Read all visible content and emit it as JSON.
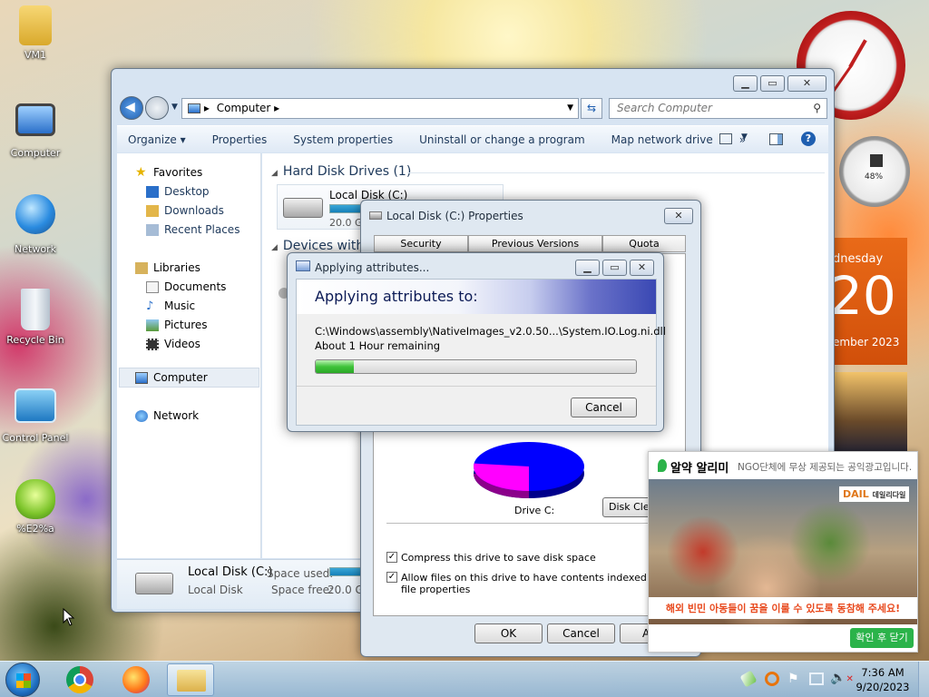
{
  "desktop": {
    "icons": [
      {
        "label": "VM1"
      },
      {
        "label": "Computer"
      },
      {
        "label": "Network"
      },
      {
        "label": "Recycle Bin"
      },
      {
        "label": "Control Panel"
      },
      {
        "label": "%E2%a"
      }
    ]
  },
  "gadgets": {
    "gauge_label": "48%",
    "calendar_day_name": "dnesday",
    "calendar_day": "20",
    "calendar_month": "ember 2023"
  },
  "explorer": {
    "breadcrumb": "Computer",
    "search_placeholder": "Search Computer",
    "toolbar": [
      "Organize",
      "Properties",
      "System properties",
      "Uninstall or change a program",
      "Map network drive",
      "»"
    ],
    "favorites_header": "Favorites",
    "favorites": [
      "Desktop",
      "Downloads",
      "Recent Places"
    ],
    "libraries_header": "Libraries",
    "libraries": [
      "Documents",
      "Music",
      "Pictures",
      "Videos"
    ],
    "computer": "Computer",
    "network": "Network",
    "group_hdd": "Hard Disk Drives (1)",
    "group_devices": "Devices with",
    "drive_name": "Local Disk (C:)",
    "drive_size": "20.0 GB",
    "details_name": "Local Disk (C:)",
    "details_type": "Local Disk",
    "details_space_used_label": "Space used:",
    "details_space_free_label": "Space free:",
    "details_space_free": "20.0 GB"
  },
  "properties": {
    "title": "Local Disk (C:) Properties",
    "tabs": [
      "Security",
      "Previous Versions",
      "Quota"
    ],
    "drive_label": "Drive C:",
    "disk_cleanup": "Disk Clea",
    "compress_label": "Compress this drive to save disk space",
    "index_label_line1": "Allow files on this drive to have contents indexed in additio",
    "index_label_line2": "file properties",
    "ok": "OK",
    "cancel": "Cancel",
    "apply": "A",
    "pie": {
      "used_fraction": 0.27,
      "used_color": "#ff00ff",
      "free_color": "#0000ff"
    }
  },
  "applying": {
    "title": "Applying attributes...",
    "heading": "Applying attributes to:",
    "path": "C:\\Windows\\assembly\\NativeImages_v2.0.50...\\System.IO.Log.ni.dll",
    "remaining": "About 1 Hour remaining",
    "progress_fraction": 0.12,
    "cancel": "Cancel"
  },
  "ad": {
    "title": "알약 알리미",
    "subtitle": "NGO단체에 무상 제공되는 공익광고입니다.",
    "brand": "DAIL",
    "brand_small": "데일리다일",
    "banner_text": "해외 빈민 아동들이 꿈을 이룰 수 있도록 동참해 주세요!",
    "close_button": "확인 후 닫기"
  },
  "taskbar": {
    "time": "7:36 AM",
    "date": "9/20/2023"
  }
}
